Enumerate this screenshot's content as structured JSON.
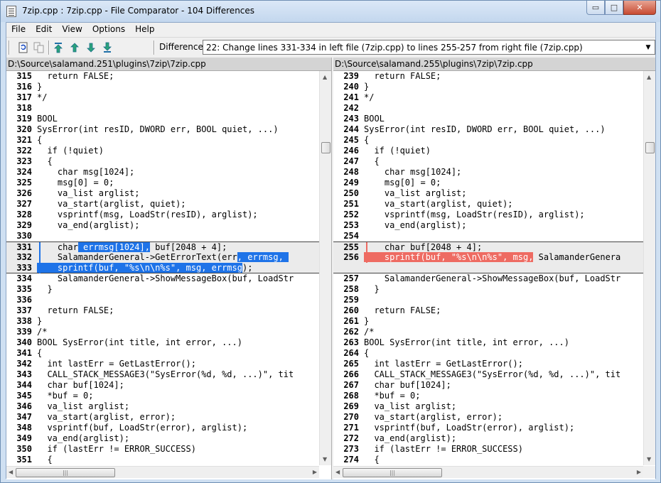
{
  "window": {
    "title": "7zip.cpp : 7zip.cpp - File Comparator - 104 Differences",
    "minimize": "▭",
    "maximize": "□",
    "close": "✕"
  },
  "menu": [
    "File",
    "Edit",
    "View",
    "Options",
    "Help"
  ],
  "toolbar": {
    "difference_label": "Difference",
    "difference_value": "22: Change lines 331-334 in left file (7zip.cpp) to lines 255-257 from right file (7zip.cpp)",
    "icons": [
      "recompare-icon",
      "copy-icon",
      "first-diff-icon",
      "prev-diff-icon",
      "next-diff-icon",
      "last-diff-icon"
    ]
  },
  "left": {
    "path": "D:\\Source\\salamand.251\\plugins\\7zip\\7zip.cpp",
    "lines": [
      {
        "n": "315",
        "t": "  return FALSE;"
      },
      {
        "n": "316",
        "t": "}"
      },
      {
        "n": "317",
        "t": "*/"
      },
      {
        "n": "318",
        "t": ""
      },
      {
        "n": "319",
        "t": "BOOL"
      },
      {
        "n": "320",
        "t": "SysError(int resID, DWORD err, BOOL quiet, ...)"
      },
      {
        "n": "321",
        "t": "{"
      },
      {
        "n": "322",
        "t": "  if (!quiet)"
      },
      {
        "n": "323",
        "t": "  {"
      },
      {
        "n": "324",
        "t": "    char msg[1024];"
      },
      {
        "n": "325",
        "t": "    msg[0] = 0;"
      },
      {
        "n": "326",
        "t": "    va_list arglist;"
      },
      {
        "n": "327",
        "t": "    va_start(arglist, quiet);"
      },
      {
        "n": "328",
        "t": "    vsprintf(msg, LoadStr(resID), arglist);"
      },
      {
        "n": "329",
        "t": "    va_end(arglist);"
      },
      {
        "n": "330",
        "t": ""
      },
      {
        "n": "331",
        "pre": "    char",
        "hl": " errmsg[1024],",
        "post": " buf[2048 + 4];"
      },
      {
        "n": "332",
        "pre": "    SalamanderGeneral->GetErrorText(err",
        "hl": ", errmsg, ",
        "post": ""
      },
      {
        "n": "333",
        "pre": "",
        "hl": "    sprintf(buf, \"%s\\n\\n%s\", msg, errmsg",
        "post": ");"
      },
      {
        "n": "334",
        "t": "    SalamanderGeneral->ShowMessageBox(buf, LoadStr"
      },
      {
        "n": "335",
        "t": "  }"
      },
      {
        "n": "336",
        "t": ""
      },
      {
        "n": "337",
        "t": "  return FALSE;"
      },
      {
        "n": "338",
        "t": "}"
      },
      {
        "n": "339",
        "t": "/*"
      },
      {
        "n": "340",
        "t": "BOOL SysError(int title, int error, ...)"
      },
      {
        "n": "341",
        "t": "{"
      },
      {
        "n": "342",
        "t": "  int lastErr = GetLastError();"
      },
      {
        "n": "343",
        "t": "  CALL_STACK_MESSAGE3(\"SysError(%d, %d, ...)\", tit"
      },
      {
        "n": "344",
        "t": "  char buf[1024];"
      },
      {
        "n": "345",
        "t": "  *buf = 0;"
      },
      {
        "n": "346",
        "t": "  va_list arglist;"
      },
      {
        "n": "347",
        "t": "  va_start(arglist, error);"
      },
      {
        "n": "348",
        "t": "  vsprintf(buf, LoadStr(error), arglist);"
      },
      {
        "n": "349",
        "t": "  va_end(arglist);"
      },
      {
        "n": "350",
        "t": "  if (lastErr != ERROR_SUCCESS)"
      },
      {
        "n": "351",
        "t": "  {"
      }
    ]
  },
  "right": {
    "path": "D:\\Source\\salamand.255\\plugins\\7zip\\7zip.cpp",
    "lines": [
      {
        "n": "239",
        "t": "  return FALSE;"
      },
      {
        "n": "240",
        "t": "}"
      },
      {
        "n": "241",
        "t": "*/"
      },
      {
        "n": "242",
        "t": ""
      },
      {
        "n": "243",
        "t": "BOOL"
      },
      {
        "n": "244",
        "t": "SysError(int resID, DWORD err, BOOL quiet, ...)"
      },
      {
        "n": "245",
        "t": "{"
      },
      {
        "n": "246",
        "t": "  if (!quiet)"
      },
      {
        "n": "247",
        "t": "  {"
      },
      {
        "n": "248",
        "t": "    char msg[1024];"
      },
      {
        "n": "249",
        "t": "    msg[0] = 0;"
      },
      {
        "n": "250",
        "t": "    va_list arglist;"
      },
      {
        "n": "251",
        "t": "    va_start(arglist, quiet);"
      },
      {
        "n": "252",
        "t": "    vsprintf(msg, LoadStr(resID), arglist);"
      },
      {
        "n": "253",
        "t": "    va_end(arglist);"
      },
      {
        "n": "254",
        "t": ""
      },
      {
        "n": "255",
        "pre": "    char",
        "hl": "",
        "post": " buf[2048 + 4];"
      },
      {
        "n": "256",
        "pre": "",
        "hl": "    sprintf(buf, \"%s\\n\\n%s\", msg,",
        "post": " SalamanderGenera"
      },
      {
        "n": "",
        "t": ""
      },
      {
        "n": "257",
        "t": "    SalamanderGeneral->ShowMessageBox(buf, LoadStr"
      },
      {
        "n": "258",
        "t": "  }"
      },
      {
        "n": "259",
        "t": ""
      },
      {
        "n": "260",
        "t": "  return FALSE;"
      },
      {
        "n": "261",
        "t": "}"
      },
      {
        "n": "262",
        "t": "/*"
      },
      {
        "n": "263",
        "t": "BOOL SysError(int title, int error, ...)"
      },
      {
        "n": "264",
        "t": "{"
      },
      {
        "n": "265",
        "t": "  int lastErr = GetLastError();"
      },
      {
        "n": "266",
        "t": "  CALL_STACK_MESSAGE3(\"SysError(%d, %d, ...)\", tit"
      },
      {
        "n": "267",
        "t": "  char buf[1024];"
      },
      {
        "n": "268",
        "t": "  *buf = 0;"
      },
      {
        "n": "269",
        "t": "  va_list arglist;"
      },
      {
        "n": "270",
        "t": "  va_start(arglist, error);"
      },
      {
        "n": "271",
        "t": "  vsprintf(buf, LoadStr(error), arglist);"
      },
      {
        "n": "272",
        "t": "  va_end(arglist);"
      },
      {
        "n": "273",
        "t": "  if (lastErr != ERROR_SUCCESS)"
      },
      {
        "n": "274",
        "t": "  {"
      }
    ]
  },
  "colors": {
    "change_background": "#ebebeb",
    "left_highlight": "#1e73e8",
    "right_highlight": "#ee6b62"
  }
}
